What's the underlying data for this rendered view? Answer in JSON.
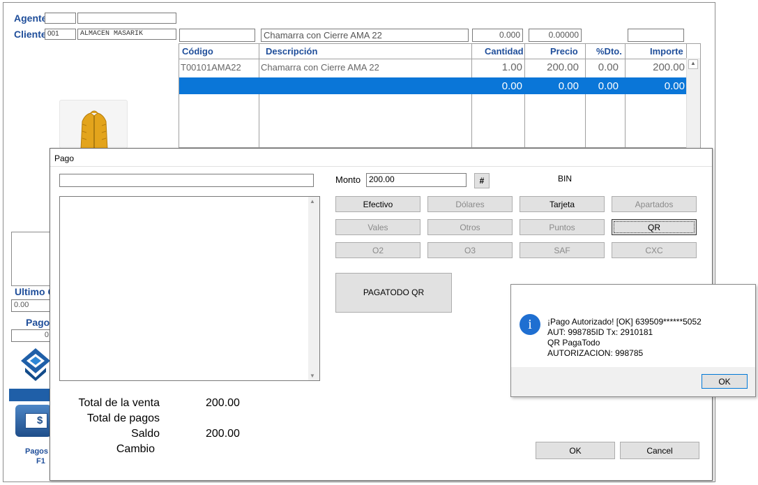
{
  "header": {
    "agente_label": "Agente",
    "cliente_label": "Cliente",
    "cliente_code": "001",
    "cliente_name": "ALMACEN MASARIK",
    "desc_field": "Chamarra con Cierre AMA 22",
    "qty_field": "0.000",
    "price_field": "0.00000"
  },
  "grid": {
    "headers": [
      "Código",
      "Descripción",
      "Cantidad",
      "Precio",
      "%Dto.",
      "Importe"
    ],
    "rows": [
      {
        "codigo": "T00101AMA22",
        "descripcion": "Chamarra con Cierre AMA 22",
        "cantidad": "1.00",
        "precio": "200.00",
        "dto": "0.00",
        "importe": "200.00"
      }
    ],
    "selected": {
      "cantidad": "0.00",
      "precio": "0.00",
      "dto": "0.00",
      "importe": "0.00"
    }
  },
  "left_panel": {
    "ultimo_label": "Ultimo C",
    "ultimo_value": "0.00",
    "pagos_label": "Pago",
    "pagos_value": "0",
    "pagos_button_label": "Pagos",
    "pagos_key": "F1",
    "dollar_symbol": "$"
  },
  "pago_dialog": {
    "title": "Pago",
    "monto_label": "Monto",
    "monto_value": "200.00",
    "hash_label": "#",
    "bin_label": "BIN",
    "buttons": {
      "efectivo": "Efectivo",
      "dolares": "Dólares",
      "tarjeta": "Tarjeta",
      "apartados": "Apartados",
      "vales": "Vales",
      "otros": "Otros",
      "puntos": "Puntos",
      "qr": "QR",
      "o2": "O2",
      "o3": "O3",
      "saf": "SAF",
      "cxc": "CXC",
      "pagatodo": "PAGATODO QR",
      "ok": "OK",
      "cancel": "Cancel"
    },
    "totals": {
      "venta_label": "Total de la venta",
      "venta_value": "200.00",
      "pagos_label": "Total de pagos",
      "saldo_label": "Saldo",
      "saldo_value": "200.00",
      "cambio_label": "Cambio"
    }
  },
  "message_box": {
    "line1": "¡Pago Autorizado! [OK] 639509******5052",
    "line2": "AUT: 998785ID Tx: 2910181",
    "line3": "QR PagaTodo",
    "line4": "AUTORIZACION: 998785",
    "ok_label": "OK",
    "icon": "info-icon"
  },
  "colors": {
    "accent": "#0a76d8",
    "label_blue": "#1f4e9a"
  }
}
